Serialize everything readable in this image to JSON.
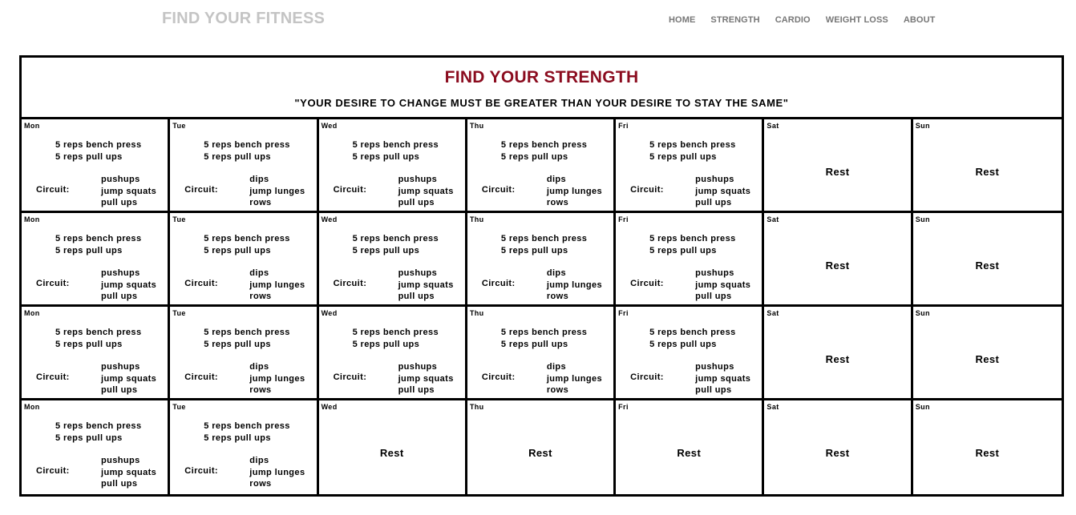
{
  "site": {
    "logo": "FIND YOUR FITNESS",
    "nav": [
      "HOME",
      "STRENGTH",
      "CARDIO",
      "WEIGHT LOSS",
      "ABOUT"
    ]
  },
  "page": {
    "title": "FIND YOUR STRENGTH",
    "quote": "\"YOUR DESIRE TO CHANGE MUST BE GREATER THAN YOUR DESIRE TO STAY THE SAME\""
  },
  "circuit_label": "Circuit:",
  "weeks": [
    [
      {
        "day": "Mon",
        "type": "workout",
        "main": [
          "5 reps bench press",
          "5 reps pull ups"
        ],
        "circuit": [
          "pushups",
          "jump squats",
          "pull ups"
        ]
      },
      {
        "day": "Tue",
        "type": "workout",
        "main": [
          "5 reps bench press",
          "5 reps pull ups"
        ],
        "circuit": [
          "dips",
          "jump lunges",
          "rows"
        ]
      },
      {
        "day": "Wed",
        "type": "workout",
        "main": [
          "5 reps bench press",
          "5 reps pull ups"
        ],
        "circuit": [
          "pushups",
          "jump squats",
          "pull ups"
        ]
      },
      {
        "day": "Thu",
        "type": "workout",
        "main": [
          "5 reps bench press",
          "5 reps pull ups"
        ],
        "circuit": [
          "dips",
          "jump lunges",
          "rows"
        ]
      },
      {
        "day": "Fri",
        "type": "workout",
        "main": [
          "5 reps bench press",
          "5 reps pull ups"
        ],
        "circuit": [
          "pushups",
          "jump squats",
          "pull ups"
        ]
      },
      {
        "day": "Sat",
        "type": "rest",
        "rest": "Rest"
      },
      {
        "day": "Sun",
        "type": "rest",
        "rest": "Rest"
      }
    ],
    [
      {
        "day": "Mon",
        "type": "workout",
        "main": [
          "5 reps bench press",
          "5 reps pull ups"
        ],
        "circuit": [
          "pushups",
          "jump squats",
          "pull ups"
        ]
      },
      {
        "day": "Tue",
        "type": "workout",
        "main": [
          "5 reps bench press",
          "5 reps pull ups"
        ],
        "circuit": [
          "dips",
          "jump lunges",
          "rows"
        ]
      },
      {
        "day": "Wed",
        "type": "workout",
        "main": [
          "5 reps bench press",
          "5 reps pull ups"
        ],
        "circuit": [
          "pushups",
          "jump squats",
          "pull ups"
        ]
      },
      {
        "day": "Thu",
        "type": "workout",
        "main": [
          "5 reps bench press",
          "5 reps pull ups"
        ],
        "circuit": [
          "dips",
          "jump lunges",
          "rows"
        ]
      },
      {
        "day": "Fri",
        "type": "workout",
        "main": [
          "5 reps bench press",
          "5 reps pull ups"
        ],
        "circuit": [
          "pushups",
          "jump squats",
          "pull ups"
        ]
      },
      {
        "day": "Sat",
        "type": "rest",
        "rest": "Rest"
      },
      {
        "day": "Sun",
        "type": "rest",
        "rest": "Rest"
      }
    ],
    [
      {
        "day": "Mon",
        "type": "workout",
        "main": [
          "5 reps bench press",
          "5 reps pull ups"
        ],
        "circuit": [
          "pushups",
          "jump squats",
          "pull ups"
        ]
      },
      {
        "day": "Tue",
        "type": "workout",
        "main": [
          "5 reps bench press",
          "5 reps pull ups"
        ],
        "circuit": [
          "dips",
          "jump lunges",
          "rows"
        ]
      },
      {
        "day": "Wed",
        "type": "workout",
        "main": [
          "5 reps bench press",
          "5 reps pull ups"
        ],
        "circuit": [
          "pushups",
          "jump squats",
          "pull ups"
        ]
      },
      {
        "day": "Thu",
        "type": "workout",
        "main": [
          "5 reps bench press",
          "5 reps pull ups"
        ],
        "circuit": [
          "dips",
          "jump lunges",
          "rows"
        ]
      },
      {
        "day": "Fri",
        "type": "workout",
        "main": [
          "5 reps bench press",
          "5 reps pull ups"
        ],
        "circuit": [
          "pushups",
          "jump squats",
          "pull ups"
        ]
      },
      {
        "day": "Sat",
        "type": "rest",
        "rest": "Rest"
      },
      {
        "day": "Sun",
        "type": "rest",
        "rest": "Rest"
      }
    ],
    [
      {
        "day": "Mon",
        "type": "workout",
        "main": [
          "5 reps bench press",
          "5 reps pull ups"
        ],
        "circuit": [
          "pushups",
          "jump squats",
          "pull ups"
        ]
      },
      {
        "day": "Tue",
        "type": "workout",
        "main": [
          "5 reps bench press",
          "5 reps pull ups"
        ],
        "circuit": [
          "dips",
          "jump lunges",
          "rows"
        ]
      },
      {
        "day": "Wed",
        "type": "rest",
        "rest": "Rest"
      },
      {
        "day": "Thu",
        "type": "rest",
        "rest": "Rest"
      },
      {
        "day": "Fri",
        "type": "rest",
        "rest": "Rest"
      },
      {
        "day": "Sat",
        "type": "rest",
        "rest": "Rest"
      },
      {
        "day": "Sun",
        "type": "rest",
        "rest": "Rest"
      }
    ]
  ],
  "colors": {
    "title": "#8b0c1f",
    "logo": "#c4c4c4",
    "nav": "#777777"
  }
}
